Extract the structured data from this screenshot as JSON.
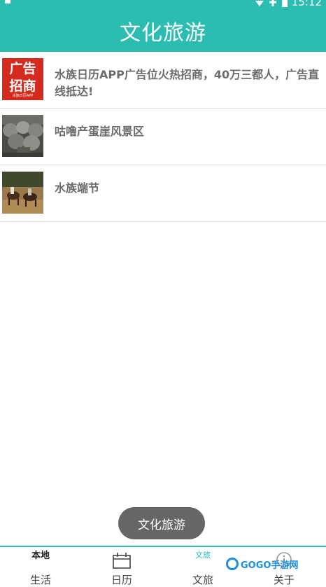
{
  "status_bar": {
    "time": "15:12"
  },
  "app_bar": {
    "title": "文化旅游"
  },
  "list": {
    "items": [
      {
        "title": "水族日历APP广告位火热招商，40万三都人，广告直线抵达!",
        "thumb_text_top": "广告",
        "thumb_text_bottom": "招商",
        "thumb_caption": "水族日历APP"
      },
      {
        "title": "咕噜产蛋崖风景区"
      },
      {
        "title": "水族端节"
      }
    ]
  },
  "toast": {
    "text": "文化旅游"
  },
  "tab_bar": {
    "tabs": [
      {
        "label": "生活",
        "icon_text": "本地"
      },
      {
        "label": "日历"
      },
      {
        "label": "文旅",
        "icon_text": "文旅"
      },
      {
        "label": "关于"
      }
    ]
  },
  "watermark": {
    "text": "GOGO手游网"
  },
  "colors": {
    "accent": "#2bbcb2",
    "ad_red": "#d42b1e",
    "title_gray": "#6b6b6b"
  }
}
